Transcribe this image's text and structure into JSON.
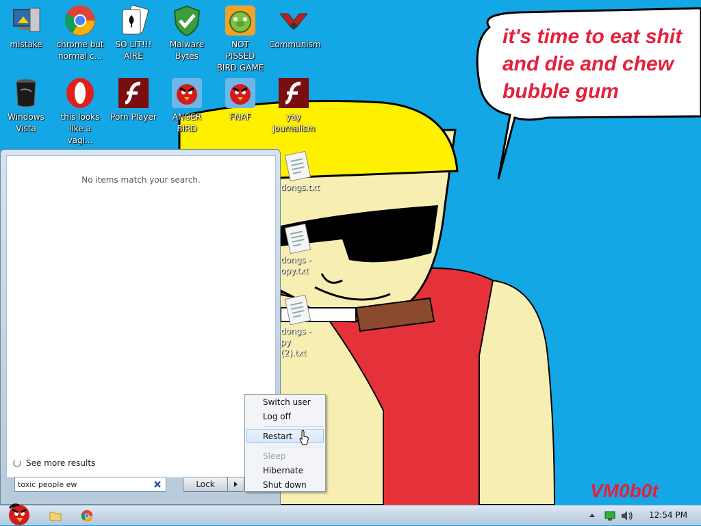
{
  "desktop": {
    "icons_row1": [
      {
        "label": "mistake",
        "icon": "computer-icon"
      },
      {
        "label": "chrome but normal c...",
        "icon": "chrome-icon"
      },
      {
        "label": "SO LIT!!! AIRE",
        "icon": "solitaire-icon"
      },
      {
        "label": "Malware Bytes",
        "icon": "shield-check-icon"
      },
      {
        "label": "NOT PISSED BIRD GAME",
        "icon": "green-pig-icon"
      },
      {
        "label": "Communism",
        "icon": "emblem-icon"
      }
    ],
    "icons_row2": [
      {
        "label": "Windows Vista",
        "icon": "vista-bin-icon"
      },
      {
        "label": "this looks like a vagi...",
        "icon": "opera-icon"
      },
      {
        "label": "Porn Player",
        "icon": "flash-icon"
      },
      {
        "label": "ANGER BIRD",
        "icon": "red-bird-icon"
      },
      {
        "label": "FNAF",
        "icon": "red-bird-icon"
      },
      {
        "label": "yay journalism",
        "icon": "flash-icon"
      }
    ],
    "text_files": [
      {
        "label": "dongs.txt"
      },
      {
        "label": "dongs - opy.txt"
      },
      {
        "label": "dongs - py (2).txt"
      }
    ],
    "wallpaper": {
      "speech_lines": [
        "it's time to eat shit",
        "and die and chew",
        "bubble gum"
      ],
      "signature": "VM0b0t"
    }
  },
  "start_menu": {
    "no_results_text": "No items match your search.",
    "see_more_label": "See more results",
    "search": {
      "value": "toxic people ew",
      "placeholder": ""
    },
    "lock_label": "Lock",
    "power_menu": {
      "items": [
        "Switch user",
        "Log off",
        "Restart",
        "Sleep",
        "Hibernate",
        "Shut down"
      ],
      "highlighted": "Restart",
      "disabled": "Sleep"
    }
  },
  "taskbar": {
    "clock": "12:54 PM",
    "pinned": [
      "angry-bird-start-icon",
      "folder-icon",
      "chrome-icon"
    ]
  },
  "colors": {
    "desktop_bg": "#14a7e6",
    "speech_text": "#e5203c",
    "signature": "#e5203c"
  }
}
